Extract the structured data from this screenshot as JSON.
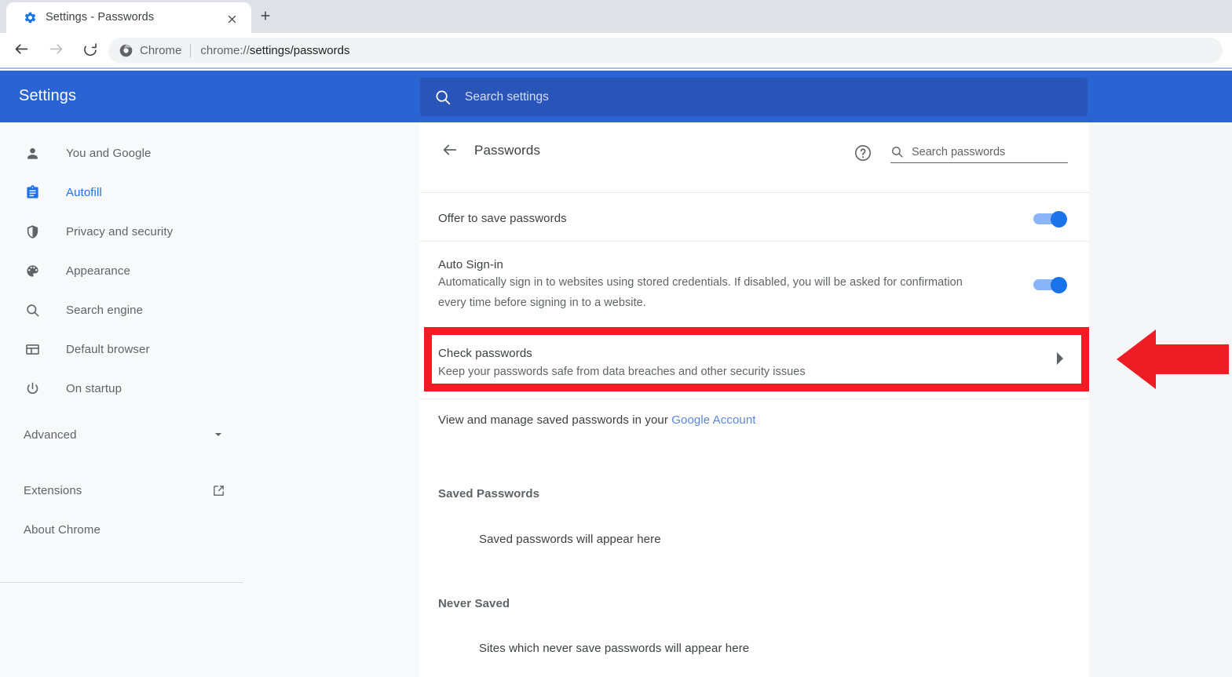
{
  "browser": {
    "tab": {
      "title": "Settings - Passwords",
      "favicon_icon": "gear-icon",
      "close_icon": "close-icon"
    },
    "new_tab_icon": "plus-icon",
    "nav": {
      "back_icon": "arrow-left-icon",
      "forward_icon": "arrow-right-icon",
      "reload_icon": "reload-icon"
    },
    "omnibox": {
      "site_icon": "chrome-icon",
      "site_label": "Chrome",
      "url_prefix": "chrome://",
      "url_main": "settings/passwords"
    }
  },
  "settings": {
    "title": "Settings",
    "search": {
      "icon": "search-icon",
      "placeholder": "Search settings",
      "value": ""
    },
    "sidebar": {
      "items": [
        {
          "label": "You and Google",
          "icon": "person-icon",
          "active": false
        },
        {
          "label": "Autofill",
          "icon": "clipboard-icon",
          "active": true
        },
        {
          "label": "Privacy and security",
          "icon": "shield-icon",
          "active": false
        },
        {
          "label": "Appearance",
          "icon": "palette-icon",
          "active": false
        },
        {
          "label": "Search engine",
          "icon": "search-icon",
          "active": false
        },
        {
          "label": "Default browser",
          "icon": "browser-window-icon",
          "active": false
        },
        {
          "label": "On startup",
          "icon": "power-icon",
          "active": false
        }
      ],
      "advanced": {
        "label": "Advanced",
        "icon": "chevron-down-icon"
      },
      "footer": [
        {
          "label": "Extensions",
          "icon": "open-in-new-icon"
        },
        {
          "label": "About Chrome",
          "icon": ""
        }
      ]
    }
  },
  "passwords_page": {
    "back_icon": "arrow-left-icon",
    "title": "Passwords",
    "help_icon": "help-circle-icon",
    "search": {
      "icon": "search-icon",
      "placeholder": "Search passwords",
      "value": ""
    },
    "offer_to_save": {
      "label": "Offer to save passwords",
      "toggle_state": "on"
    },
    "auto_signin": {
      "label": "Auto Sign-in",
      "description": "Automatically sign in to websites using stored credentials. If disabled, you will be asked for confirmation every time before signing in to a website.",
      "toggle_state": "on"
    },
    "check_passwords": {
      "label": "Check passwords",
      "description": "Keep your passwords safe from data breaches and other security issues",
      "chevron_icon": "chevron-right-icon",
      "highlighted": true,
      "highlight_color": "#ee1c25"
    },
    "manage_line": {
      "text_before": "View and manage saved passwords in your ",
      "link_text": "Google Account"
    },
    "saved_passwords": {
      "heading": "Saved Passwords",
      "empty_text": "Saved passwords will appear here"
    },
    "never_saved": {
      "heading": "Never Saved",
      "empty_text": "Sites which never save passwords will appear here"
    }
  },
  "annotation": {
    "arrow_icon": "arrow-left-pointer-icon",
    "arrow_color": "#ee1c25"
  }
}
